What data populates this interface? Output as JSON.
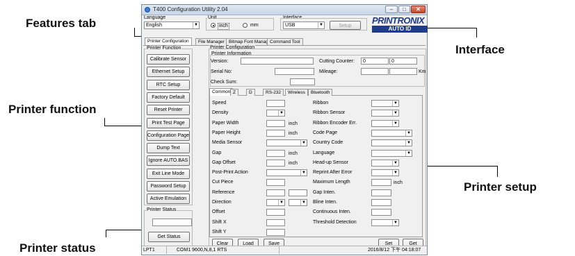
{
  "callouts": {
    "features_tab": "Features tab",
    "interface": "Interface",
    "printer_function": "Printer function",
    "printer_setup": "Printer setup",
    "printer_status": "Printer status"
  },
  "window": {
    "title": "T400 Configuration Utility 2.04",
    "minimize": "–",
    "maximize": "□",
    "close": "✕"
  },
  "top": {
    "language_label": "Language",
    "language_value": "English",
    "unit_label": "Unit",
    "unit_inch": "inch",
    "unit_mm": "mm",
    "unit_selected": "inch",
    "interface_label": "Interface",
    "interface_value": "USB",
    "setup_button": "Setup"
  },
  "logo": {
    "brand": "PRINTRONIX",
    "sub": "AUTO ID",
    "color": "#1f3c8c"
  },
  "main_tabs": [
    "Printer Configuration",
    "File Manager",
    "Bitmap Font Manager",
    "Command Tool"
  ],
  "printer_function": {
    "title": "Printer Function",
    "buttons": [
      "Calibrate Sensor",
      "Ethernet Setup",
      "RTC Setup",
      "Factory Default",
      "Reset Printer",
      "Print Test Page",
      "Configuration Page",
      "Dump Text",
      "Ignore AUTO.BAS",
      "Exit Line Mode",
      "Password Setup",
      "Active Emulation"
    ]
  },
  "printer_status": {
    "title": "Printer Status",
    "value": "",
    "get_status": "Get Status"
  },
  "config": {
    "title": "Printer Configuration",
    "info_title": "Printer Information",
    "version": "Version:",
    "serial": "Serial No:",
    "checksum": "Check Sum:",
    "cutting": "Cutting Counter:",
    "cutting_a": "0",
    "cutting_b": "0",
    "mileage": "Mileage:",
    "km": "Km"
  },
  "setup_tabs": [
    "Common",
    "Z",
    "D",
    "RS-232",
    "Wireless",
    "Bluetooth"
  ],
  "left_params": [
    {
      "label": "Speed",
      "type": "text",
      "unit": ""
    },
    {
      "label": "Density",
      "type": "dropdown",
      "unit": ""
    },
    {
      "label": "Paper Width",
      "type": "text",
      "unit": "inch"
    },
    {
      "label": "Paper Height",
      "type": "text",
      "unit": "inch"
    },
    {
      "label": "Media Sensor",
      "type": "dropdown-wide",
      "unit": ""
    },
    {
      "label": "Gap",
      "type": "text",
      "unit": "inch"
    },
    {
      "label": "Gap Offset",
      "type": "text",
      "unit": "inch"
    },
    {
      "label": "Post-Print Action",
      "type": "dropdown-wide",
      "unit": ""
    },
    {
      "label": "Cut Piece",
      "type": "text",
      "unit": ""
    },
    {
      "label": "Reference",
      "type": "text-pair",
      "unit": ""
    },
    {
      "label": "Direction",
      "type": "dropdown-pair",
      "unit": ""
    },
    {
      "label": "Offset",
      "type": "text",
      "unit": ""
    },
    {
      "label": "Shift X",
      "type": "text",
      "unit": ""
    },
    {
      "label": "Shift Y",
      "type": "text",
      "unit": ""
    }
  ],
  "right_params": [
    {
      "label": "Ribbon",
      "type": "dropdown",
      "unit": ""
    },
    {
      "label": "Ribbon Sensor",
      "type": "dropdown",
      "unit": ""
    },
    {
      "label": "Ribbon Encoder Err.",
      "type": "dropdown",
      "unit": ""
    },
    {
      "label": "Code Page",
      "type": "dropdown-wide",
      "unit": ""
    },
    {
      "label": "Country Code",
      "type": "dropdown-wide",
      "unit": ""
    },
    {
      "label": "Language",
      "type": "dropdown-wide",
      "unit": ""
    },
    {
      "label": "Head-up Sensor",
      "type": "dropdown",
      "unit": ""
    },
    {
      "label": "Reprint After Error",
      "type": "dropdown",
      "unit": ""
    },
    {
      "label": "Maximum Length",
      "type": "text",
      "unit": "inch"
    },
    {
      "label": "Gap Inten.",
      "type": "text",
      "unit": ""
    },
    {
      "label": "Bline Inten.",
      "type": "text",
      "unit": ""
    },
    {
      "label": "Continuous Inten.",
      "type": "text",
      "unit": ""
    },
    {
      "label": "Threshold Detection",
      "type": "dropdown",
      "unit": ""
    }
  ],
  "bottom_buttons": {
    "clear": "Clear",
    "load": "Load",
    "save": "Save",
    "set": "Set",
    "get": "Get"
  },
  "status_bar": {
    "port": "LPT1",
    "com": "COM1 9600,N,8,1 RTS",
    "datetime": "2016/8/12 下午 04:18:07"
  }
}
